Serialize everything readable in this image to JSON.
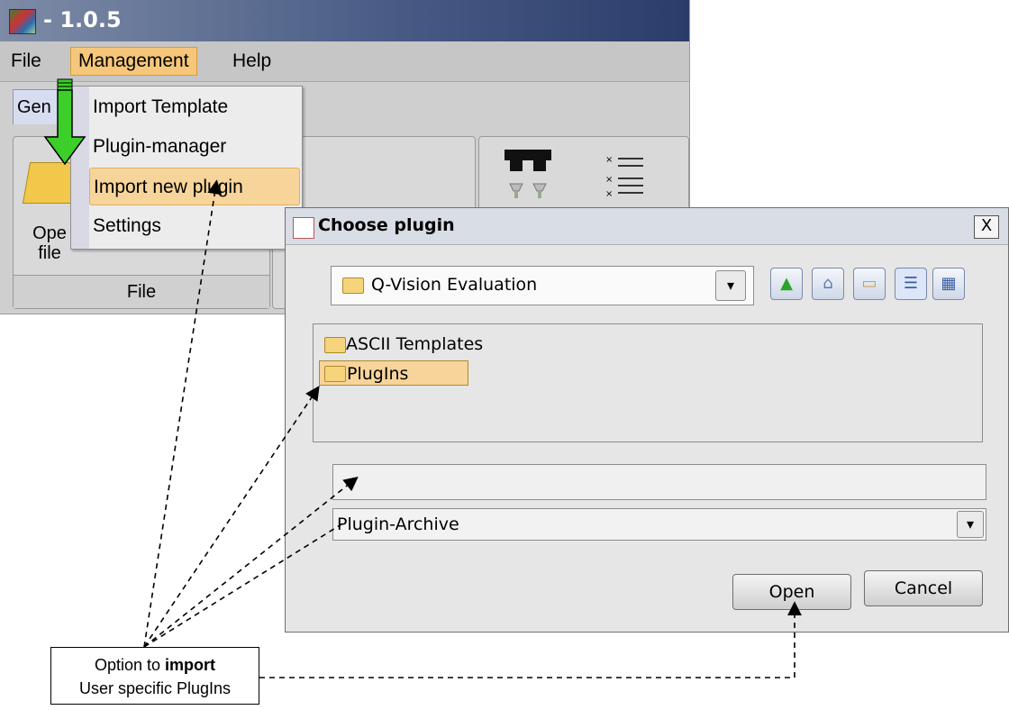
{
  "main_window": {
    "title": "- 1.0.5",
    "menu": [
      "File",
      "Management",
      "Help"
    ],
    "tab_general_fragment": "Gen",
    "file_group": {
      "open_label_line1": "Ope",
      "open_label_line2": "file",
      "group_label": "File"
    }
  },
  "management_menu": {
    "items": [
      "Import Template",
      "Plugin-manager",
      "Import new plugin",
      "Settings"
    ],
    "highlighted": "Import new plugin"
  },
  "dialog": {
    "title": "Choose plugin",
    "close_label": "X",
    "look_in": "Q-Vision Evaluation",
    "files": [
      "ASCII Templates",
      "PlugIns"
    ],
    "selected_file": "PlugIns",
    "file_name": "",
    "file_type": "Plugin-Archive",
    "open_label": "Open",
    "cancel_label": "Cancel",
    "toolbar_icons": [
      "up-folder-icon",
      "home-folder-icon",
      "new-folder-icon",
      "list-view-icon",
      "details-view-icon"
    ]
  },
  "callout": {
    "line1_prefix": "Option to ",
    "line1_bold": "import",
    "line2": "User specific PlugIns"
  },
  "colors": {
    "menu_highlight": "#f7d49a",
    "arrow_green": "#3ccf2a",
    "title_gradient_dark": "#2b3c6a"
  }
}
